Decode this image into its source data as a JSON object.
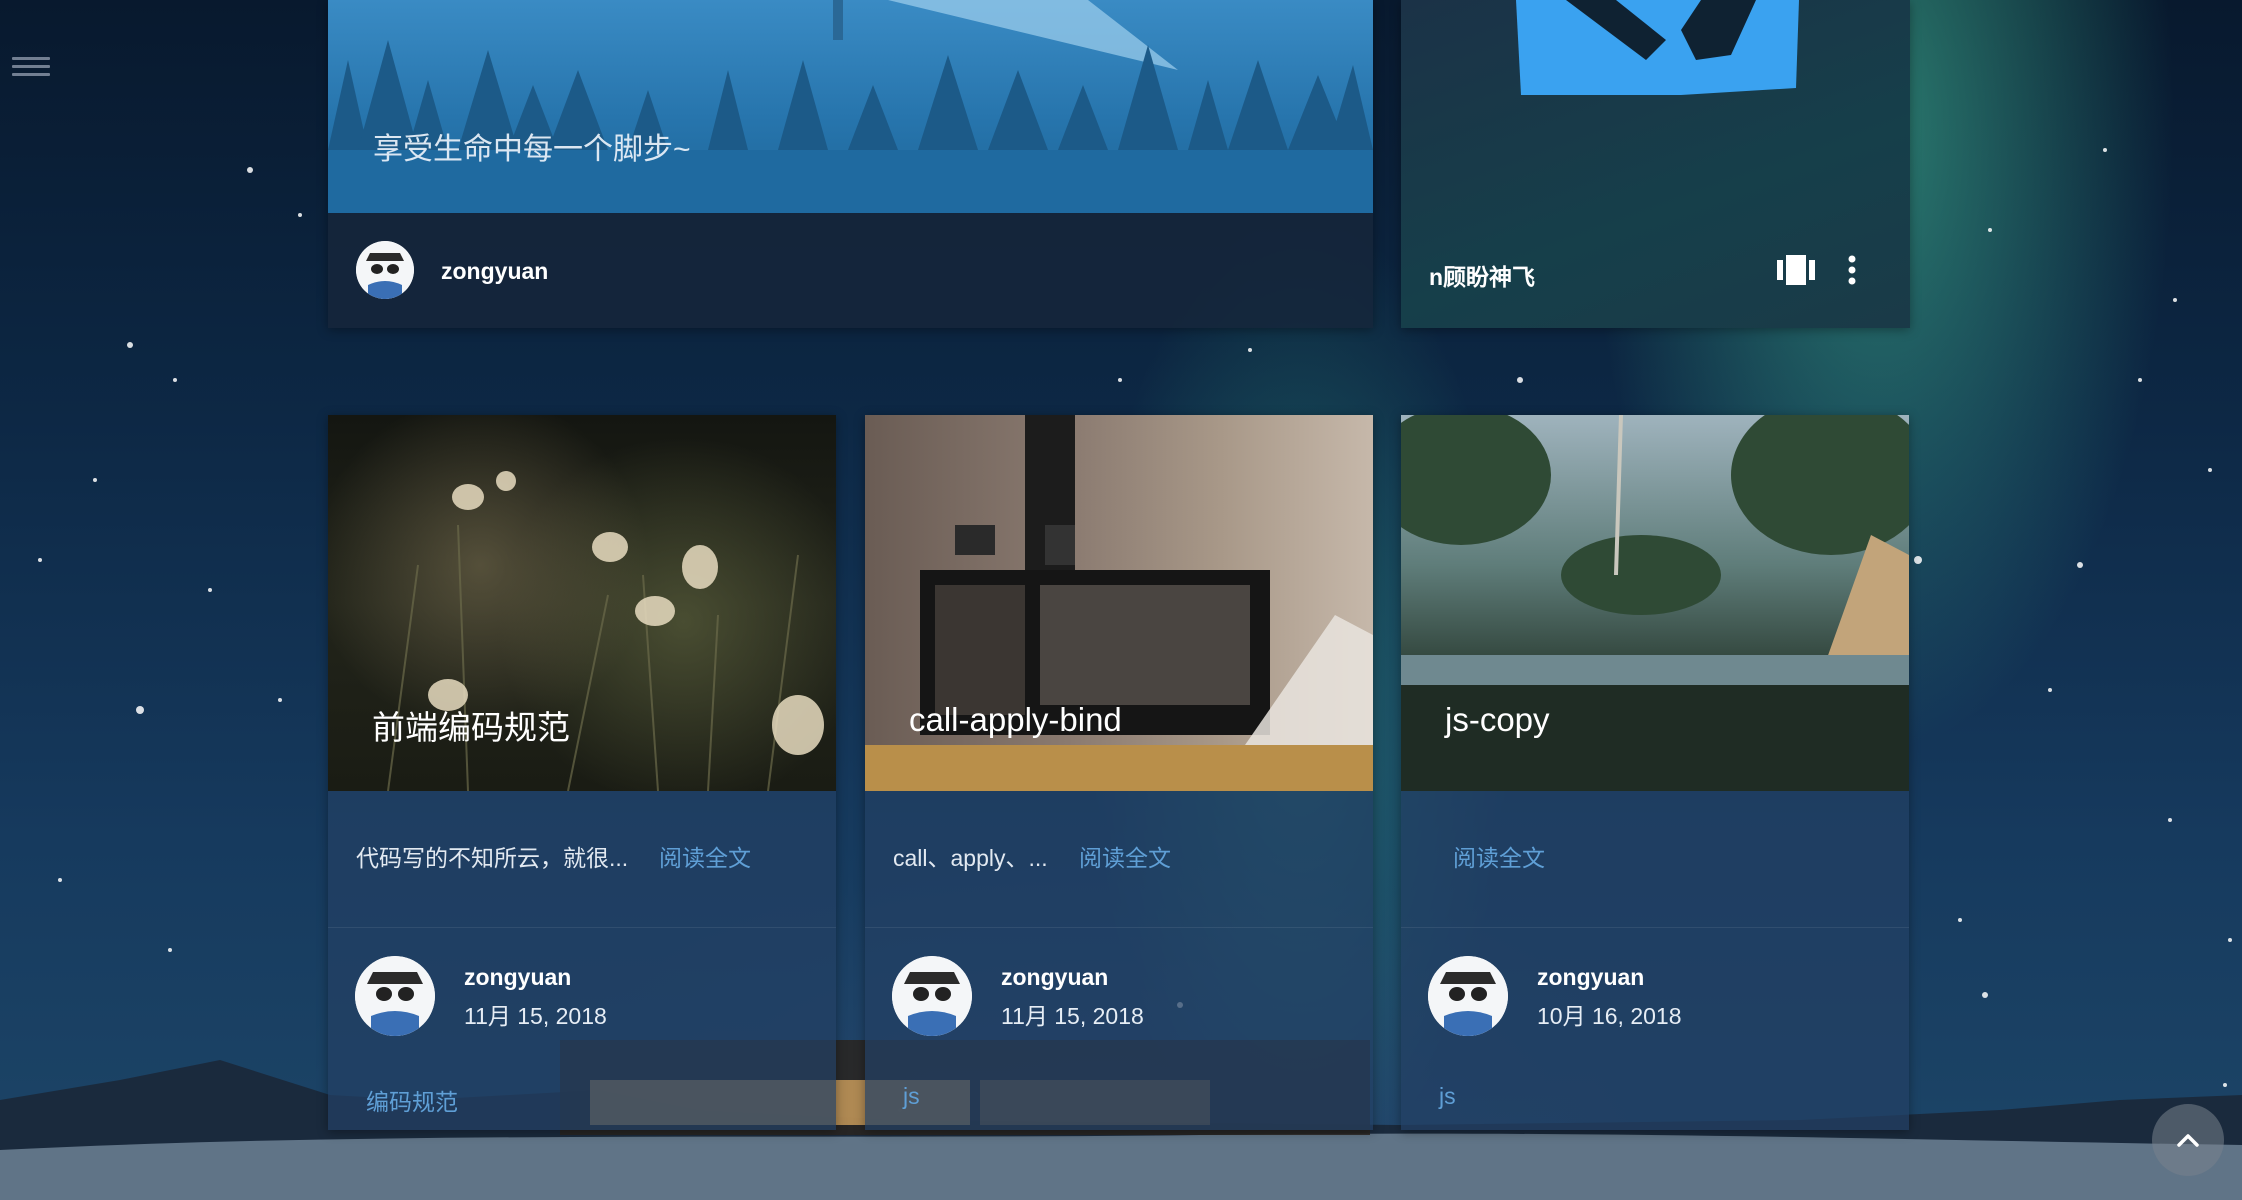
{
  "top_cards": [
    {
      "caption": "享受生命中每一个脚步~",
      "author": "zongyuan"
    },
    {
      "author": "n顾盼神飞",
      "icons": [
        "carousel-icon",
        "more-vert-icon"
      ]
    }
  ],
  "posts": [
    {
      "title": "前端编码规范",
      "excerpt": "代码写的不知所云，就很...",
      "read_more": "阅读全文",
      "author": "zongyuan",
      "date": "11月 15, 2018",
      "tag": "编码规范"
    },
    {
      "title": "call-apply-bind",
      "excerpt": "call、apply、...",
      "read_more": "阅读全文",
      "author": "zongyuan",
      "date": "11月 15, 2018",
      "tag": "js"
    },
    {
      "title": "js-copy",
      "excerpt": "",
      "read_more": "阅读全文",
      "author": "zongyuan",
      "date": "10月 16, 2018",
      "tag": "js"
    }
  ],
  "colors": {
    "accent_link": "#5f9fd6",
    "card_body": "#22406a"
  },
  "icons": {
    "menu": "menu-icon",
    "scroll_top": "chevron-up-icon"
  }
}
